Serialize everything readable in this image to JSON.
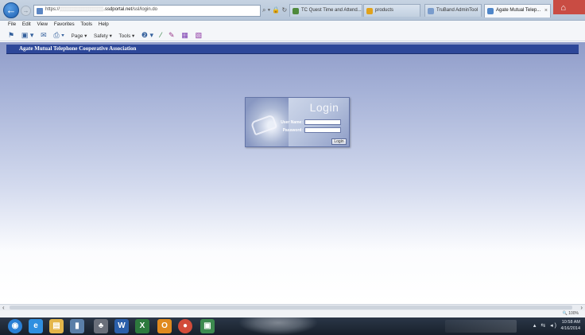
{
  "browser": {
    "url_prefix": "https://",
    "url_host": ".ssdportal.net",
    "url_path": "/ssl/login.do",
    "tabs": [
      {
        "label": "TC Quest Time and Attend...",
        "color": "#4f8a3c"
      },
      {
        "label": "products",
        "color": "#e0a21c"
      },
      {
        "label": "TruBand AdminTool",
        "color": "#7a9ccc"
      },
      {
        "label": "Agate Mutual Telep...",
        "color": "#4f86c9"
      }
    ],
    "close_tab": "×"
  },
  "menubar": [
    "File",
    "Edit",
    "View",
    "Favorites",
    "Tools",
    "Help"
  ],
  "commandbar": {
    "page": "Page ▾",
    "safety": "Safety ▾",
    "tools": "Tools ▾"
  },
  "page": {
    "organization": "Agate Mutual Telephone Cooperative Association",
    "login": {
      "title": "Login",
      "username_label": "User Name:",
      "password_label": "Password:",
      "submit": "Login"
    }
  },
  "status": {
    "zoom": "100%"
  },
  "taskbar": {
    "time": "10:58 AM",
    "date": "4/16/2014",
    "apps": [
      {
        "name": "start",
        "glyph": "◉",
        "color": "#2a7fd4"
      },
      {
        "name": "internet-explorer",
        "glyph": "e",
        "color": "#2f8fe0"
      },
      {
        "name": "file-explorer",
        "glyph": "▤",
        "color": "#e4b64a"
      },
      {
        "name": "notepad",
        "glyph": "▮",
        "color": "#5b7fa8"
      },
      {
        "name": "people",
        "glyph": "♣",
        "color": "#6a6f7a"
      },
      {
        "name": "word",
        "glyph": "W",
        "color": "#2b5faa"
      },
      {
        "name": "excel",
        "glyph": "X",
        "color": "#2d7a3d"
      },
      {
        "name": "outlook",
        "glyph": "O",
        "color": "#e08a1e"
      },
      {
        "name": "chrome",
        "glyph": "●",
        "color": "#d24b3a"
      },
      {
        "name": "remote-app",
        "glyph": "▣",
        "color": "#3d8a4f"
      }
    ]
  }
}
